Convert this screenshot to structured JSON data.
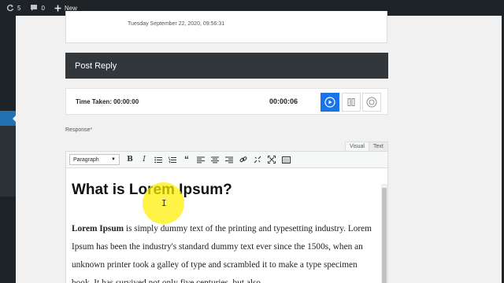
{
  "admin_bar": {
    "updates_count": "5",
    "comments_count": "0",
    "new_label": "New"
  },
  "previous_reply": {
    "date": "Tuesday September 22, 2020, 09:56:31"
  },
  "reply": {
    "header": "Post Reply",
    "timer_label": "Time Taken: 00:00:00",
    "timer_live": "00:00:06",
    "response_label": "Response",
    "required_marker": "*"
  },
  "editor": {
    "tabs": {
      "visual": "Visual",
      "text": "Text"
    },
    "format_select": "Paragraph",
    "toolbar_icons": [
      "bold-icon",
      "italic-icon",
      "bullet-list-icon",
      "numbered-list-icon",
      "blockquote-icon",
      "align-left-icon",
      "align-center-icon",
      "align-right-icon",
      "link-icon",
      "unlink-icon",
      "fullscreen-icon",
      "toolbar-toggle-icon"
    ],
    "heading": "What is Lorem Ipsum?",
    "paragraph_bold": "Lorem Ipsum",
    "paragraph_rest": " is simply dummy text of the printing and typesetting industry. Lorem Ipsum has been the industry's standard dummy text ever since the 1500s, when an unknown printer took a galley of type and scrambled it to make a type specimen book. It has survived not only five centuries, but also"
  },
  "colors": {
    "admin_dark": "#1d2327",
    "accent_blue": "#1a73e8",
    "highlight_yellow": "#ffee00"
  }
}
